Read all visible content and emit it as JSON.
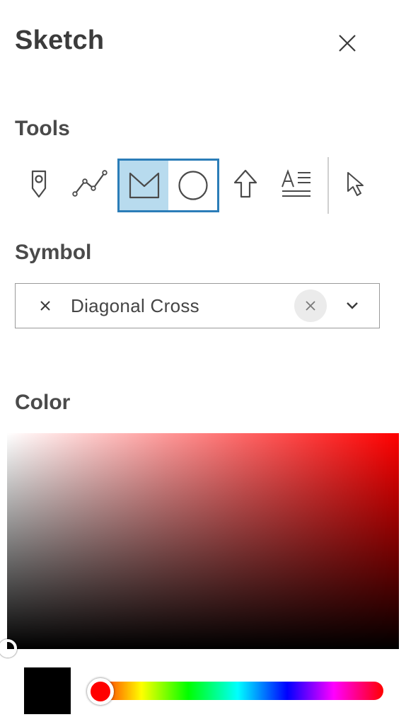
{
  "panel": {
    "title": "Sketch",
    "close_icon": "close-icon"
  },
  "tools": {
    "label": "Tools",
    "items": [
      {
        "name": "point",
        "icon": "map-pin-icon"
      },
      {
        "name": "polyline",
        "icon": "polyline-icon"
      },
      {
        "name": "polygon",
        "icon": "polygon-icon",
        "selected": true
      },
      {
        "name": "circle",
        "icon": "circle-icon"
      },
      {
        "name": "arrow",
        "icon": "arrow-up-icon"
      },
      {
        "name": "text",
        "icon": "text-icon"
      },
      {
        "name": "select",
        "icon": "cursor-icon"
      }
    ]
  },
  "symbol": {
    "label": "Symbol",
    "value": "Diagonal Cross"
  },
  "color": {
    "label": "Color",
    "hue": "#ff0000",
    "selected": "#000000"
  },
  "colors": {
    "accent": "#2b7db8",
    "selected_tool_bg": "#b8dbee"
  }
}
